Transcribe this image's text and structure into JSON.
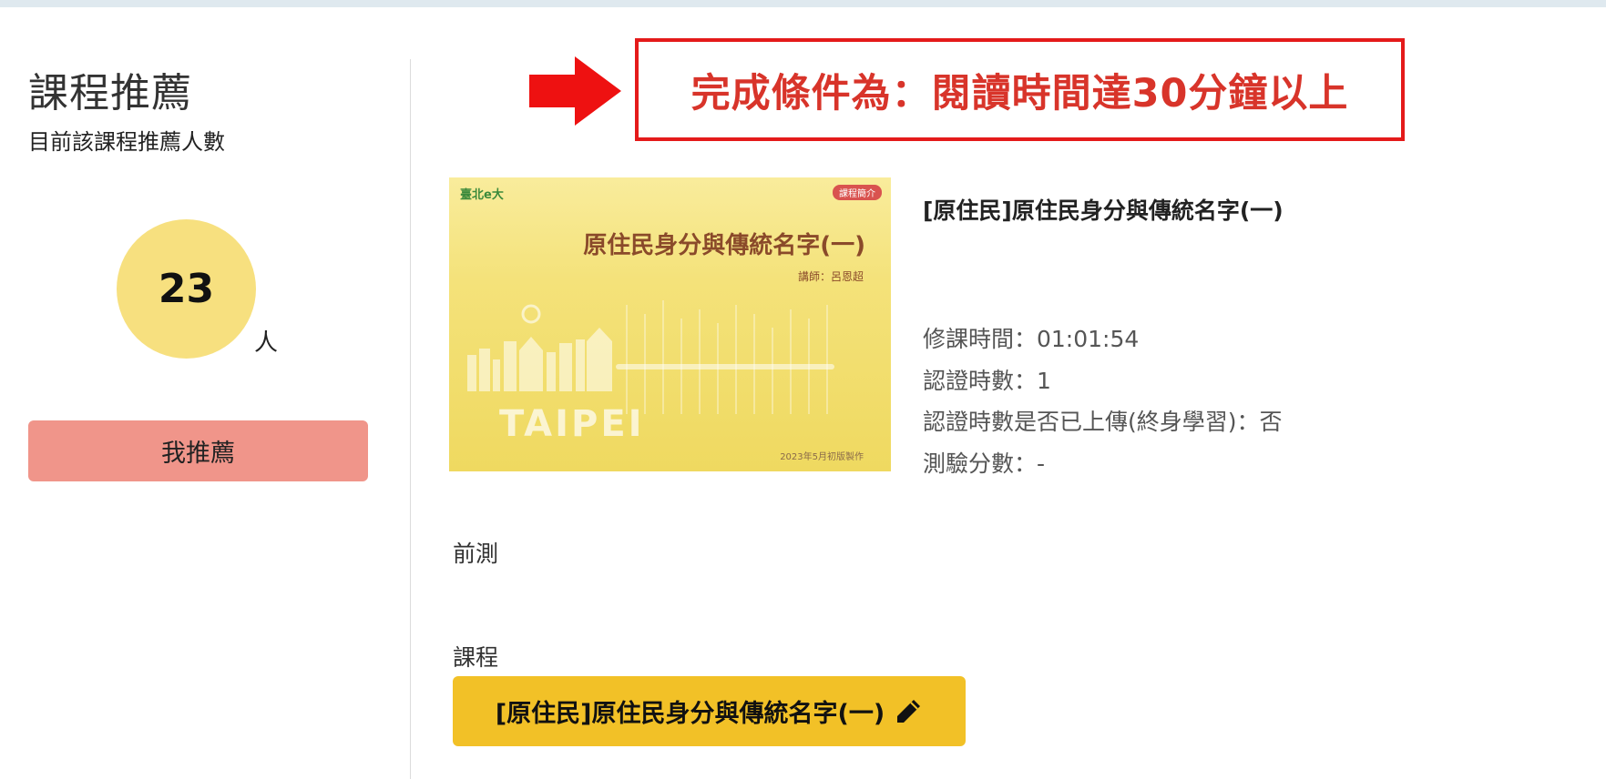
{
  "sidebar": {
    "title": "課程推薦",
    "subtitle": "目前該課程推薦人數",
    "count": "23",
    "count_unit": "人",
    "recommend_button": "我推薦"
  },
  "notice": {
    "text": "完成條件為：閱讀時間達30分鐘以上",
    "arrow_icon": "right-arrow-icon",
    "color": "#d8342a"
  },
  "course": {
    "thumbnail": {
      "logo": "臺北e大",
      "badge": "課程簡介",
      "title": "原住民身分與傳統名字(一)",
      "lecturer": "講師：呂恩超",
      "city": "TAIPEI",
      "date": "2023年5月初版製作"
    },
    "title": "[原住民]原住民身分與傳統名字(一)",
    "info": [
      "修課時間：01:01:54",
      "認證時數：1",
      "認證時數是否已上傳(終身學習)：否",
      "測驗分數：-"
    ]
  },
  "sections": {
    "pretest_label": "前測",
    "course_label": "課程",
    "course_button": "[原住民]原住民身分與傳統名字(一)",
    "course_button_icon": "pencil-icon"
  },
  "colors": {
    "recommend_button": "#f0958a",
    "count_circle": "#f7e07f",
    "course_button": "#f2c127",
    "notice_border": "#e41a1a"
  }
}
